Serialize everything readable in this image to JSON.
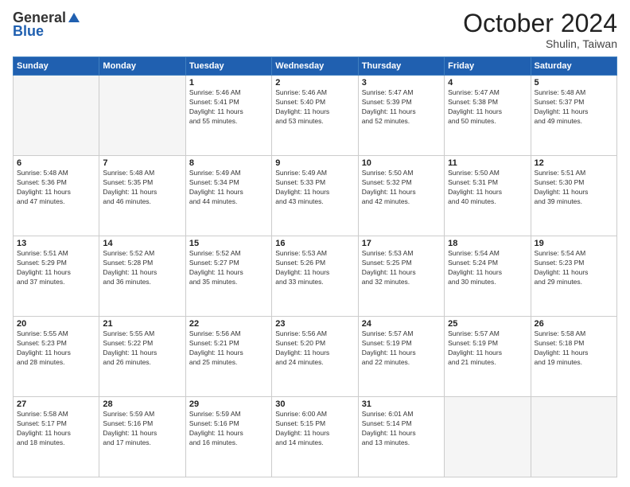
{
  "header": {
    "logo_general": "General",
    "logo_blue": "Blue",
    "month_title": "October 2024",
    "location": "Shulin, Taiwan"
  },
  "weekdays": [
    "Sunday",
    "Monday",
    "Tuesday",
    "Wednesday",
    "Thursday",
    "Friday",
    "Saturday"
  ],
  "weeks": [
    [
      {
        "day": "",
        "info": ""
      },
      {
        "day": "",
        "info": ""
      },
      {
        "day": "1",
        "info": "Sunrise: 5:46 AM\nSunset: 5:41 PM\nDaylight: 11 hours\nand 55 minutes."
      },
      {
        "day": "2",
        "info": "Sunrise: 5:46 AM\nSunset: 5:40 PM\nDaylight: 11 hours\nand 53 minutes."
      },
      {
        "day": "3",
        "info": "Sunrise: 5:47 AM\nSunset: 5:39 PM\nDaylight: 11 hours\nand 52 minutes."
      },
      {
        "day": "4",
        "info": "Sunrise: 5:47 AM\nSunset: 5:38 PM\nDaylight: 11 hours\nand 50 minutes."
      },
      {
        "day": "5",
        "info": "Sunrise: 5:48 AM\nSunset: 5:37 PM\nDaylight: 11 hours\nand 49 minutes."
      }
    ],
    [
      {
        "day": "6",
        "info": "Sunrise: 5:48 AM\nSunset: 5:36 PM\nDaylight: 11 hours\nand 47 minutes."
      },
      {
        "day": "7",
        "info": "Sunrise: 5:48 AM\nSunset: 5:35 PM\nDaylight: 11 hours\nand 46 minutes."
      },
      {
        "day": "8",
        "info": "Sunrise: 5:49 AM\nSunset: 5:34 PM\nDaylight: 11 hours\nand 44 minutes."
      },
      {
        "day": "9",
        "info": "Sunrise: 5:49 AM\nSunset: 5:33 PM\nDaylight: 11 hours\nand 43 minutes."
      },
      {
        "day": "10",
        "info": "Sunrise: 5:50 AM\nSunset: 5:32 PM\nDaylight: 11 hours\nand 42 minutes."
      },
      {
        "day": "11",
        "info": "Sunrise: 5:50 AM\nSunset: 5:31 PM\nDaylight: 11 hours\nand 40 minutes."
      },
      {
        "day": "12",
        "info": "Sunrise: 5:51 AM\nSunset: 5:30 PM\nDaylight: 11 hours\nand 39 minutes."
      }
    ],
    [
      {
        "day": "13",
        "info": "Sunrise: 5:51 AM\nSunset: 5:29 PM\nDaylight: 11 hours\nand 37 minutes."
      },
      {
        "day": "14",
        "info": "Sunrise: 5:52 AM\nSunset: 5:28 PM\nDaylight: 11 hours\nand 36 minutes."
      },
      {
        "day": "15",
        "info": "Sunrise: 5:52 AM\nSunset: 5:27 PM\nDaylight: 11 hours\nand 35 minutes."
      },
      {
        "day": "16",
        "info": "Sunrise: 5:53 AM\nSunset: 5:26 PM\nDaylight: 11 hours\nand 33 minutes."
      },
      {
        "day": "17",
        "info": "Sunrise: 5:53 AM\nSunset: 5:25 PM\nDaylight: 11 hours\nand 32 minutes."
      },
      {
        "day": "18",
        "info": "Sunrise: 5:54 AM\nSunset: 5:24 PM\nDaylight: 11 hours\nand 30 minutes."
      },
      {
        "day": "19",
        "info": "Sunrise: 5:54 AM\nSunset: 5:23 PM\nDaylight: 11 hours\nand 29 minutes."
      }
    ],
    [
      {
        "day": "20",
        "info": "Sunrise: 5:55 AM\nSunset: 5:23 PM\nDaylight: 11 hours\nand 28 minutes."
      },
      {
        "day": "21",
        "info": "Sunrise: 5:55 AM\nSunset: 5:22 PM\nDaylight: 11 hours\nand 26 minutes."
      },
      {
        "day": "22",
        "info": "Sunrise: 5:56 AM\nSunset: 5:21 PM\nDaylight: 11 hours\nand 25 minutes."
      },
      {
        "day": "23",
        "info": "Sunrise: 5:56 AM\nSunset: 5:20 PM\nDaylight: 11 hours\nand 24 minutes."
      },
      {
        "day": "24",
        "info": "Sunrise: 5:57 AM\nSunset: 5:19 PM\nDaylight: 11 hours\nand 22 minutes."
      },
      {
        "day": "25",
        "info": "Sunrise: 5:57 AM\nSunset: 5:19 PM\nDaylight: 11 hours\nand 21 minutes."
      },
      {
        "day": "26",
        "info": "Sunrise: 5:58 AM\nSunset: 5:18 PM\nDaylight: 11 hours\nand 19 minutes."
      }
    ],
    [
      {
        "day": "27",
        "info": "Sunrise: 5:58 AM\nSunset: 5:17 PM\nDaylight: 11 hours\nand 18 minutes."
      },
      {
        "day": "28",
        "info": "Sunrise: 5:59 AM\nSunset: 5:16 PM\nDaylight: 11 hours\nand 17 minutes."
      },
      {
        "day": "29",
        "info": "Sunrise: 5:59 AM\nSunset: 5:16 PM\nDaylight: 11 hours\nand 16 minutes."
      },
      {
        "day": "30",
        "info": "Sunrise: 6:00 AM\nSunset: 5:15 PM\nDaylight: 11 hours\nand 14 minutes."
      },
      {
        "day": "31",
        "info": "Sunrise: 6:01 AM\nSunset: 5:14 PM\nDaylight: 11 hours\nand 13 minutes."
      },
      {
        "day": "",
        "info": ""
      },
      {
        "day": "",
        "info": ""
      }
    ]
  ]
}
